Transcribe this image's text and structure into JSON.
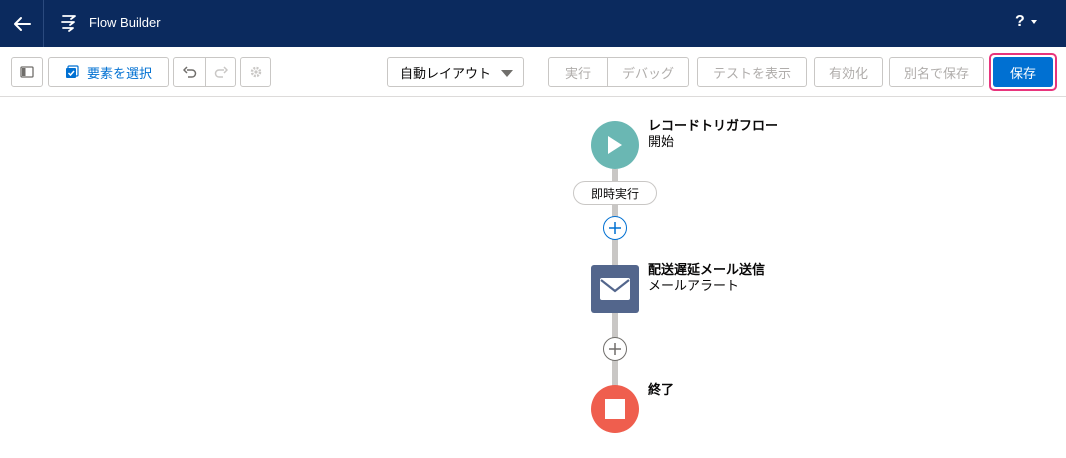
{
  "header": {
    "title": "Flow Builder",
    "help_label": "?"
  },
  "toolbar": {
    "select_elements_label": "要素を選択",
    "layout_select_value": "自動レイアウト",
    "run_label": "実行",
    "debug_label": "デバッグ",
    "test_label": "テストを表示",
    "activate_label": "有効化",
    "save_as_label": "別名で保存",
    "save_label": "保存"
  },
  "flow": {
    "start": {
      "title": "レコードトリガフロー",
      "subtitle": "開始"
    },
    "path_label": "即時実行",
    "action": {
      "title": "配送遅延メール送信",
      "subtitle": "メールアラート"
    },
    "end": {
      "title": "終了"
    }
  },
  "colors": {
    "header_bg": "#0b2a5e",
    "accent": "#0070d2",
    "start_node": "#6ab7b3",
    "action_node": "#53668c",
    "end_node": "#ef5e4e",
    "highlight": "#e8347c"
  }
}
